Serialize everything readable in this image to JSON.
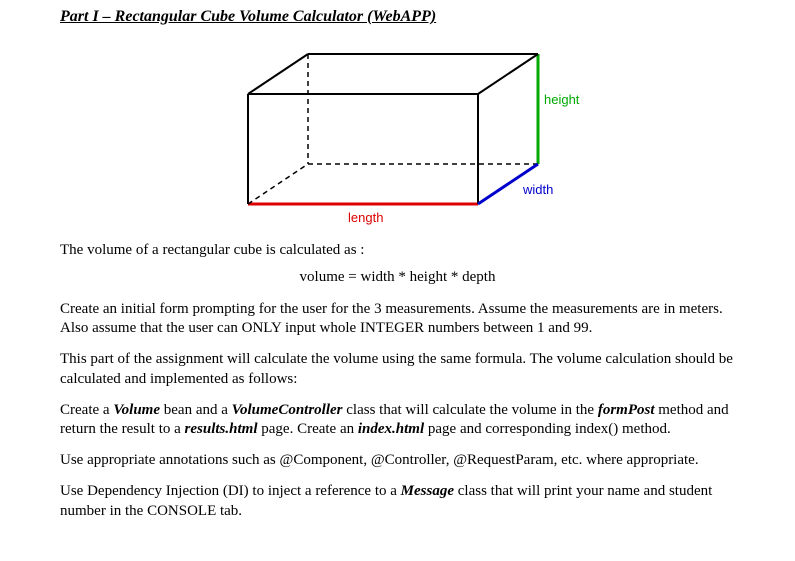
{
  "title": "Part I – Rectangular Cube Volume Calculator (WebAPP)",
  "diagram": {
    "label_height": "height",
    "label_width": "width",
    "label_length": "length",
    "colors": {
      "height": "#00aa00",
      "width": "#0000cc",
      "length": "#dd0000",
      "edge": "#000000"
    }
  },
  "intro": "The volume of a rectangular cube is calculated as :",
  "formula": "volume = width * height * depth",
  "p1": "Create an initial form prompting for the user for the 3 measurements. Assume the measurements are in meters. Also assume that the user can ONLY input whole INTEGER numbers between 1 and 99.",
  "p2": "This part of the assignment will calculate the volume using the same formula. The volume calculation should be calculated and implemented as follows:",
  "p3": {
    "t1": "Create a ",
    "volume": "Volume",
    "t2": " bean and a ",
    "controller": "VolumeController",
    "t3": " class that will calculate the volume in the ",
    "formpost": "formPost",
    "t4": " method and return the result to a ",
    "results": "results.html",
    "t5": " page. Create an ",
    "index": "index.html",
    "t6": " page and corresponding index() method."
  },
  "p4": "Use appropriate annotations such as @Component, @Controller, @RequestParam, etc. where appropriate.",
  "p5": {
    "t1": "Use Dependency Injection (DI) to inject a reference to a ",
    "message": "Message",
    "t2": " class that will print your name and student number in the CONSOLE tab."
  }
}
